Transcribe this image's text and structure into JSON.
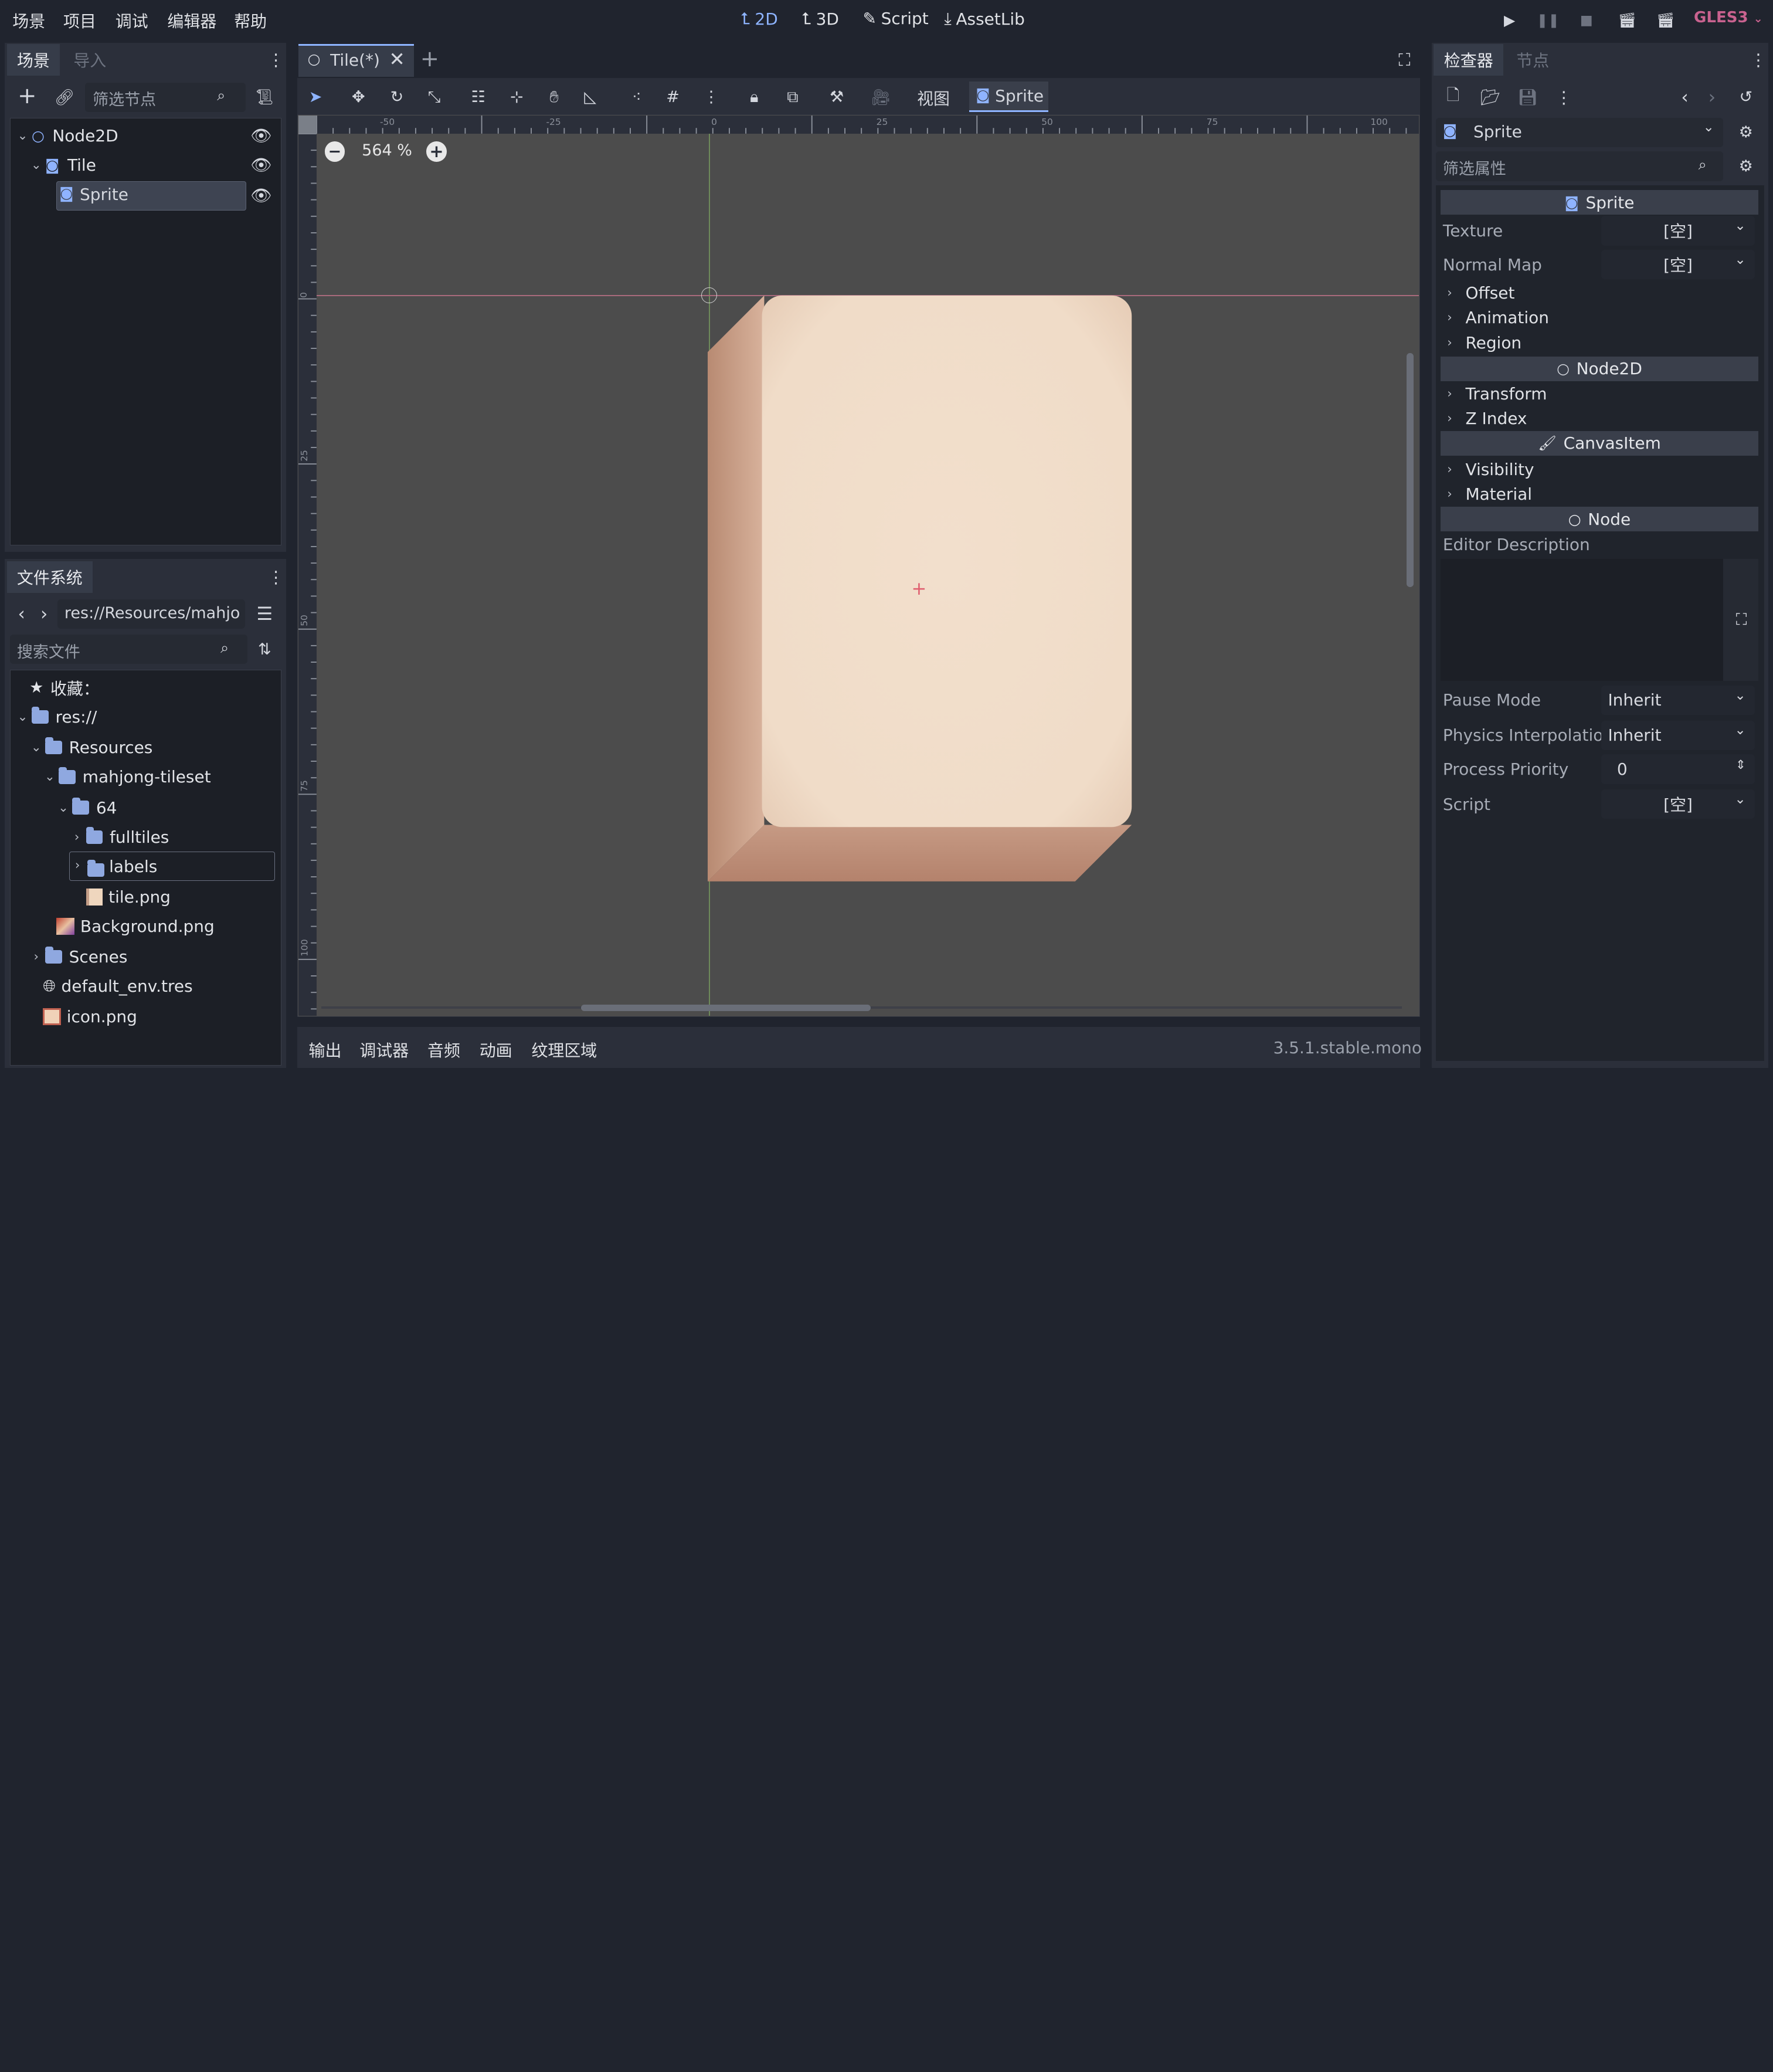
{
  "menu": [
    "场景",
    "项目",
    "调试",
    "编辑器",
    "帮助"
  ],
  "main_tabs": [
    {
      "label": "2D",
      "icon": "2d-icon",
      "active": true
    },
    {
      "label": "3D",
      "icon": "3d-icon",
      "active": false
    },
    {
      "label": "Script",
      "icon": "script-icon",
      "active": false
    },
    {
      "label": "AssetLib",
      "icon": "assetlib-icon",
      "active": false
    }
  ],
  "renderer": "GLES3",
  "scene_panel": {
    "tabs": [
      "场景",
      "导入"
    ],
    "filter_placeholder": "筛选节点",
    "nodes": [
      {
        "label": "Node2D",
        "icon": "node2d-icon"
      },
      {
        "label": "Tile",
        "icon": "sprite-icon"
      },
      {
        "label": "Sprite",
        "icon": "sprite-icon",
        "selected": true
      }
    ]
  },
  "filesystem": {
    "tab": "文件系统",
    "path": "res://Resources/mahjo",
    "search_placeholder": "搜索文件",
    "favorites": "收藏：",
    "items": [
      {
        "label": "res://",
        "icon": "folder-icon"
      },
      {
        "label": "Resources",
        "icon": "folder-icon"
      },
      {
        "label": "mahjong-tileset",
        "icon": "folder-icon"
      },
      {
        "label": "64",
        "icon": "folder-icon"
      },
      {
        "label": "fulltiles",
        "icon": "folder-icon"
      },
      {
        "label": "labels",
        "icon": "folder-icon"
      },
      {
        "label": "tile.png",
        "icon": "image-icon"
      },
      {
        "label": "Background.png",
        "icon": "image-icon"
      },
      {
        "label": "Scenes",
        "icon": "folder-icon"
      },
      {
        "label": "default_env.tres",
        "icon": "environment-icon"
      },
      {
        "label": "icon.png",
        "icon": "image-icon"
      }
    ]
  },
  "editor": {
    "scene_tab": "Tile(*)",
    "zoom": "564 %",
    "view_label": "视图",
    "sprite_label": "Sprite",
    "ruler_ticks": [
      "-50",
      "-25",
      "0",
      "25",
      "50",
      "75",
      "100"
    ],
    "vruler_ticks": [
      "0",
      "25",
      "50",
      "75",
      "100"
    ]
  },
  "bottom_panel": {
    "tabs": [
      "输出",
      "调试器",
      "音频",
      "动画",
      "纹理区域"
    ],
    "version": "3.5.1.stable.mono"
  },
  "inspector": {
    "tabs": [
      "检查器",
      "节点"
    ],
    "object": "Sprite",
    "filter_placeholder": "筛选属性",
    "sections": {
      "sprite": "Sprite",
      "node2d": "Node2D",
      "canvasitem": "CanvasItem",
      "node": "Node"
    },
    "texture_label": "Texture",
    "texture_value": "[空]",
    "normalmap_label": "Normal Map",
    "normalmap_value": "[空]",
    "groups_sprite": [
      "Offset",
      "Animation",
      "Region"
    ],
    "groups_node2d": [
      "Transform",
      "Z Index"
    ],
    "groups_canvas": [
      "Visibility",
      "Material"
    ],
    "editor_description": "Editor Description",
    "pause_mode_label": "Pause Mode",
    "pause_mode_value": "Inherit",
    "physics_label": "Physics Interpolatio",
    "physics_value": "Inherit",
    "priority_label": "Process Priority",
    "priority_value": "0",
    "script_label": "Script",
    "script_value": "[空]"
  }
}
